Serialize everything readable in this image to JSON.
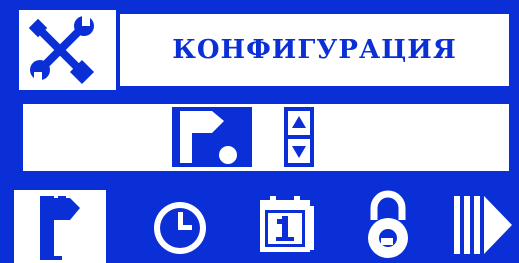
{
  "header": {
    "title": "КОНФИГУРАЦИЯ",
    "icon": "tools-icon"
  },
  "value_field": {
    "selected_icon": "flag-icon",
    "spinner_icon": "up-down-spinner-icon"
  },
  "menu": {
    "selected_index": 0,
    "items": [
      {
        "icon": "flag-icon"
      },
      {
        "icon": "clock-icon"
      },
      {
        "icon": "calendar-icon"
      },
      {
        "icon": "padlock-icon"
      },
      {
        "icon": "scroll-right-arrow-icon"
      }
    ]
  },
  "colors": {
    "accent": "#0a2fd6",
    "background": "#ffffff"
  }
}
